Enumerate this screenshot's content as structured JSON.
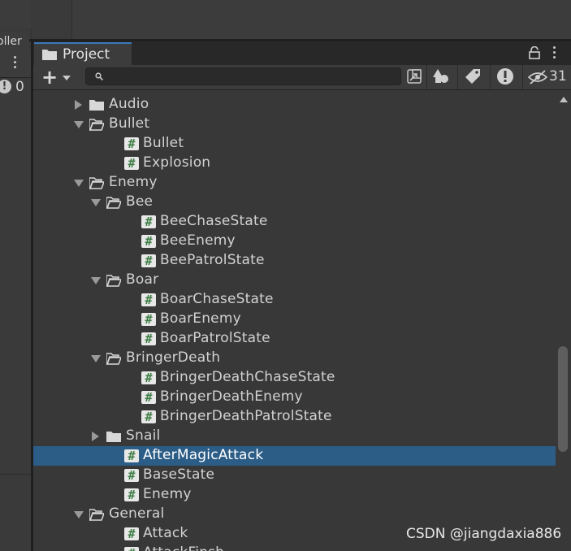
{
  "left_panel": {
    "tab_label": "oller",
    "console_count": "0"
  },
  "project_tab": {
    "title": "Project"
  },
  "toolbar": {
    "search_placeholder": "",
    "hidden_count": "31"
  },
  "tree": [
    {
      "label": "Audio",
      "type": "folder",
      "expanded": false,
      "depth": 1
    },
    {
      "label": "Bullet",
      "type": "folder",
      "expanded": true,
      "depth": 1
    },
    {
      "label": "Bullet",
      "type": "script",
      "depth": 2
    },
    {
      "label": "Explosion",
      "type": "script",
      "depth": 2
    },
    {
      "label": "Enemy",
      "type": "folder",
      "expanded": true,
      "depth": 1
    },
    {
      "label": "Bee",
      "type": "folder",
      "expanded": true,
      "depth": 2
    },
    {
      "label": "BeeChaseState",
      "type": "script",
      "depth": 3
    },
    {
      "label": "BeeEnemy",
      "type": "script",
      "depth": 3
    },
    {
      "label": "BeePatrolState",
      "type": "script",
      "depth": 3
    },
    {
      "label": "Boar",
      "type": "folder",
      "expanded": true,
      "depth": 2
    },
    {
      "label": "BoarChaseState",
      "type": "script",
      "depth": 3
    },
    {
      "label": "BoarEnemy",
      "type": "script",
      "depth": 3
    },
    {
      "label": "BoarPatrolState",
      "type": "script",
      "depth": 3
    },
    {
      "label": "BringerDeath",
      "type": "folder",
      "expanded": true,
      "depth": 2
    },
    {
      "label": "BringerDeathChaseState",
      "type": "script",
      "depth": 3
    },
    {
      "label": "BringerDeathEnemy",
      "type": "script",
      "depth": 3
    },
    {
      "label": "BringerDeathPatrolState",
      "type": "script",
      "depth": 3
    },
    {
      "label": "Snail",
      "type": "folder",
      "expanded": false,
      "depth": 2
    },
    {
      "label": "AfterMagicAttack",
      "type": "script",
      "depth": 2,
      "selected": true
    },
    {
      "label": "BaseState",
      "type": "script",
      "depth": 2
    },
    {
      "label": "Enemy",
      "type": "script",
      "depth": 2
    },
    {
      "label": "General",
      "type": "folder",
      "expanded": true,
      "depth": 1
    },
    {
      "label": "Attack",
      "type": "script",
      "depth": 2
    },
    {
      "label": "AttackFinsh",
      "type": "script",
      "depth": 2
    }
  ],
  "watermark": "CSDN @jiangdaxia886",
  "colors": {
    "selection": "#2c5d87",
    "tab_accent": "#3a79bb",
    "script_hash": "#3f7e46"
  }
}
